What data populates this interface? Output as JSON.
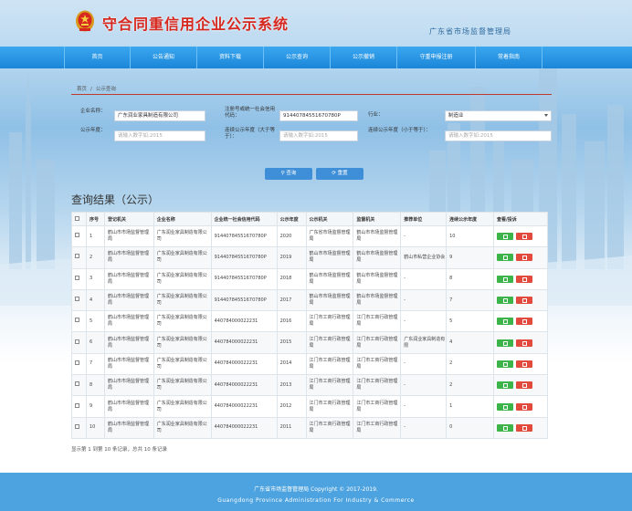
{
  "header": {
    "title": "守合同重信用企业公示系统",
    "subtitle": "广东省市场监督管理局"
  },
  "nav": [
    {
      "label": "首页"
    },
    {
      "label": "公告通知"
    },
    {
      "label": "资料下载"
    },
    {
      "label": "公示查询"
    },
    {
      "label": "公示撤销"
    },
    {
      "label": "守重申报注册"
    },
    {
      "label": "常着指南"
    }
  ],
  "breadcrumb": [
    "首页",
    "/",
    "公示查询"
  ],
  "search": {
    "company_label": "企业名称：",
    "company_value": "广东润业家具制造有限公司",
    "credit_code_label": "注册号或统一社会信用代码：",
    "credit_code_value": "91440784551670780P",
    "industry_label": "行业：",
    "industry_value": "制造业",
    "year_label": "公示年度：",
    "year_placeholder": "请输入数字如:2015",
    "years_ge_label": "连续公示年度（大于等于）：",
    "years_ge_placeholder": "请输入数字如:2015",
    "years_le_label": "连续公示年度（小于等于）：",
    "years_le_placeholder": "请输入数字如:2015",
    "query_button": "查询",
    "reset_button": "重置"
  },
  "results": {
    "title": "查询结果（公示）",
    "columns": [
      "",
      "序号",
      "登记机关",
      "企业名称",
      "企业统一社会信用代码",
      "公示年度",
      "公示机关",
      "监督机关",
      "推荐单位",
      "连续公示年度",
      "查看/投诉"
    ],
    "rows": [
      {
        "no": "1",
        "reg": "鹤山市市场监督管理局",
        "name": "广东润业家具制造有限公司",
        "code": "91440784551670780P",
        "year": "2020",
        "pub": "广东省市场监督管理局",
        "sup": "鹤山市市场监督管理局",
        "rec": "-",
        "cont": "10"
      },
      {
        "no": "2",
        "reg": "鹤山市市场监督管理局",
        "name": "广东润业家具制造有限公司",
        "code": "91440784551670780P",
        "year": "2019",
        "pub": "鹤山市市场监督管理局",
        "sup": "鹤山市市场监督管理局",
        "rec": "鹤山市私营企业协会",
        "cont": "9"
      },
      {
        "no": "3",
        "reg": "鹤山市市场监督管理局",
        "name": "广东润业家具制造有限公司",
        "code": "91440784551670780P",
        "year": "2018",
        "pub": "鹤山市市场监督管理局",
        "sup": "鹤山市市场监督管理局",
        "rec": "-",
        "cont": "8"
      },
      {
        "no": "4",
        "reg": "鹤山市市场监督管理局",
        "name": "广东润业家具制造有限公司",
        "code": "91440784551670780P",
        "year": "2017",
        "pub": "鹤山市市场监督管理局",
        "sup": "鹤山市市场监督管理局",
        "rec": "-",
        "cont": "7"
      },
      {
        "no": "5",
        "reg": "鹤山市市场监督管理局",
        "name": "广东润业家具制造有限公司",
        "code": "440784000022231",
        "year": "2016",
        "pub": "江门市工商行政管理局",
        "sup": "江门市工商行政管理局",
        "rec": "-",
        "cont": "5"
      },
      {
        "no": "6",
        "reg": "鹤山市市场监督管理局",
        "name": "广东润业家具制造有限公司",
        "code": "440784000022231",
        "year": "2015",
        "pub": "江门市工商行政管理局",
        "sup": "江门市工商行政管理局",
        "rec": "广东润业家具制造有限",
        "cont": "4"
      },
      {
        "no": "7",
        "reg": "鹤山市市场监督管理局",
        "name": "广东润业家具制造有限公司",
        "code": "440784000022231",
        "year": "2014",
        "pub": "江门市工商行政管理局",
        "sup": "江门市工商行政管理局",
        "rec": "-",
        "cont": "2"
      },
      {
        "no": "8",
        "reg": "鹤山市市场监督管理局",
        "name": "广东润业家具制造有限公司",
        "code": "440784000022231",
        "year": "2013",
        "pub": "江门市工商行政管理局",
        "sup": "江门市工商行政管理局",
        "rec": "-",
        "cont": "2"
      },
      {
        "no": "9",
        "reg": "鹤山市市场监督管理局",
        "name": "广东润业家具制造有限公司",
        "code": "440784000022231",
        "year": "2012",
        "pub": "江门市工商行政管理局",
        "sup": "江门市工商行政管理局",
        "rec": "-",
        "cont": "1"
      },
      {
        "no": "10",
        "reg": "鹤山市市场监督管理局",
        "name": "广东润业家具制造有限公司",
        "code": "440784000022231",
        "year": "2011",
        "pub": "江门市工商行政管理局",
        "sup": "江门市工商行政管理局",
        "rec": "-",
        "cont": "0"
      }
    ],
    "summary": "显示第 1 到第 10 条记录，总共 10 条记录"
  },
  "footer": {
    "line1": "广东省市场监督管理局 Copyright © 2017-2019.",
    "line2": "Guangdong Province Administration For Industry & Commerce"
  },
  "colors": {
    "nav": "#1b86d8",
    "title": "#d6281f",
    "view_button": "#3cb44a",
    "delete_button": "#e14a3d",
    "footer": "#4da3df"
  },
  "icons": [
    "national-emblem-icon",
    "search-icon",
    "refresh-icon",
    "view-icon",
    "complaint-icon"
  ]
}
